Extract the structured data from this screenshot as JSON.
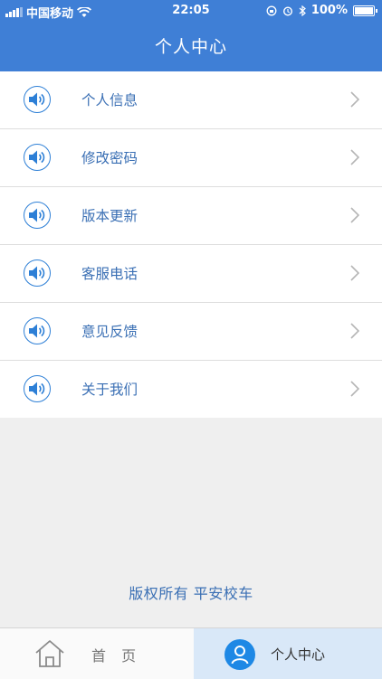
{
  "status_bar": {
    "carrier": "中国移动",
    "time": "22:05",
    "battery": "100%"
  },
  "header": {
    "title": "个人中心"
  },
  "menu": [
    {
      "label": "个人信息",
      "icon": "speaker-icon"
    },
    {
      "label": "修改密码",
      "icon": "speaker-icon"
    },
    {
      "label": "版本更新",
      "icon": "speaker-icon"
    },
    {
      "label": "客服电话",
      "icon": "speaker-icon"
    },
    {
      "label": "意见反馈",
      "icon": "speaker-icon"
    },
    {
      "label": "关于我们",
      "icon": "speaker-icon"
    }
  ],
  "footer": {
    "copyright": "版权所有 平安校车"
  },
  "tabbar": {
    "home_label": "首 页",
    "profile_label": "个人中心"
  },
  "colors": {
    "header": "#3f7fd6",
    "accent": "#2d7fd6",
    "label": "#3a6fb4",
    "active_tab": "#d9e8f8"
  }
}
